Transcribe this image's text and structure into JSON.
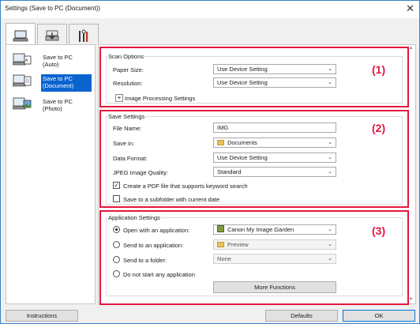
{
  "window": {
    "title": "Settings (Save to PC (Document))",
    "close_glyph": "✕"
  },
  "top_tabs": [
    {
      "icon": "computer-scan-icon"
    },
    {
      "icon": "scanner-icon"
    },
    {
      "icon": "tools-icon"
    }
  ],
  "left_nav": {
    "items": [
      {
        "label_line1": "Save to PC",
        "label_line2": "(Auto)",
        "icon": "scan-to-pc-auto-icon"
      },
      {
        "label_line1": "Save to PC",
        "label_line2": "(Document)",
        "icon": "scan-to-pc-document-icon",
        "selected": true
      },
      {
        "label_line1": "Save to PC",
        "label_line2": "(Photo)",
        "icon": "scan-to-pc-photo-icon"
      }
    ]
  },
  "scan_options": {
    "title": "Scan Options",
    "number": "(1)",
    "paper_size_label": "Paper Size:",
    "paper_size_value": "Use Device Setting",
    "resolution_label": "Resolution:",
    "resolution_value": "Use Device Setting",
    "expand_glyph": "+",
    "image_processing_label": "Image Processing Settings"
  },
  "save_settings": {
    "title": "Save Settings",
    "number": "(2)",
    "file_name_label": "File Name:",
    "file_name_value": "IMG",
    "save_in_label": "Save in:",
    "save_in_value": "Documents",
    "data_format_label": "Data Format:",
    "data_format_value": "Use Device Setting",
    "jpeg_quality_label": "JPEG Image Quality:",
    "jpeg_quality_value": "Standard",
    "pdf_keyword_label": "Create a PDF file that supports keyword search",
    "pdf_keyword_checked": true,
    "check_glyph": "✓",
    "subfolder_label": "Save to a subfolder with current date",
    "subfolder_checked": false
  },
  "application_settings": {
    "title": "Application Settings",
    "number": "(3)",
    "open_app_label": "Open with an application:",
    "open_app_value": "Canon My Image Garden",
    "send_app_label": "Send to an application:",
    "send_app_value": "Preview",
    "send_folder_label": "Send to a folder:",
    "send_folder_value": "None",
    "no_app_label": "Do not start any application",
    "selected_option": "open_app",
    "more_functions_label": "More Functions"
  },
  "footer": {
    "instructions_label": "Instructions",
    "defaults_label": "Defaults",
    "ok_label": "OK"
  },
  "colors": {
    "highlight": "#e4163d",
    "selection": "#0a64d0",
    "window_border": "#3c7fc4"
  },
  "chevron_glyph": "⌄",
  "scroll_up_glyph": "▲",
  "scroll_down_glyph": "▼"
}
